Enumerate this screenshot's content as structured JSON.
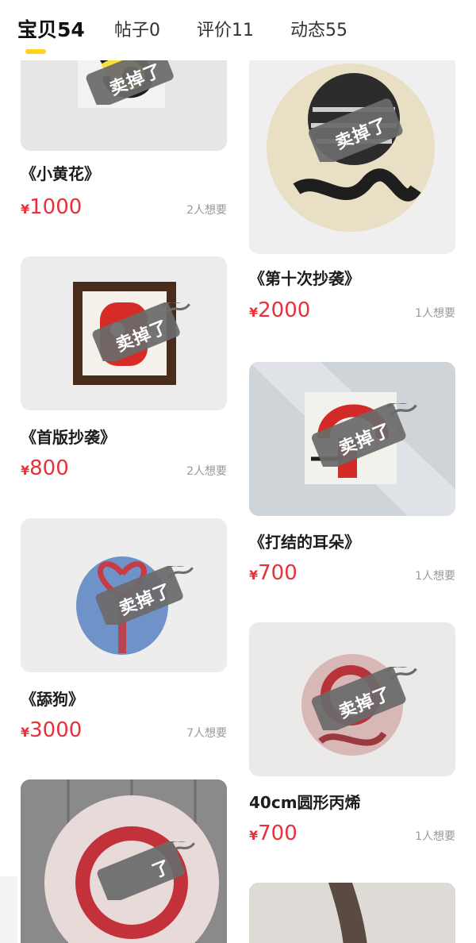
{
  "tabs": [
    {
      "label": "宝贝",
      "count": "54"
    },
    {
      "label": "帖子",
      "count": "0"
    },
    {
      "label": "评价",
      "count": "11"
    },
    {
      "label": "动态",
      "count": "55"
    }
  ],
  "stamp_text": "卖掉了",
  "stamp_text_partial": "了",
  "currency": "¥",
  "items": [
    {
      "title": "《小黄花》",
      "price": "1000",
      "want": "2人想要",
      "sold": true
    },
    {
      "title": "《第十次抄袭》",
      "price": "2000",
      "want": "1人想要",
      "sold": true
    },
    {
      "title": "《首版抄袭》",
      "price": "800",
      "want": "2人想要",
      "sold": true
    },
    {
      "title": "《打结的耳朵》",
      "price": "700",
      "want": "1人想要",
      "sold": true
    },
    {
      "title": "《舔狗》",
      "price": "3000",
      "want": "7人想要",
      "sold": true
    },
    {
      "title": "40cm圆形丙烯",
      "price": "700",
      "want": "1人想要",
      "sold": true
    },
    {
      "title": "",
      "price": "",
      "want": "",
      "sold": true
    },
    {
      "title": "",
      "price": "",
      "want": "",
      "sold": false
    }
  ],
  "colors": {
    "accent_underline": "#ffd21e",
    "price": "#e8313b",
    "stamp": "#6b6b6b",
    "muted": "#999999"
  }
}
